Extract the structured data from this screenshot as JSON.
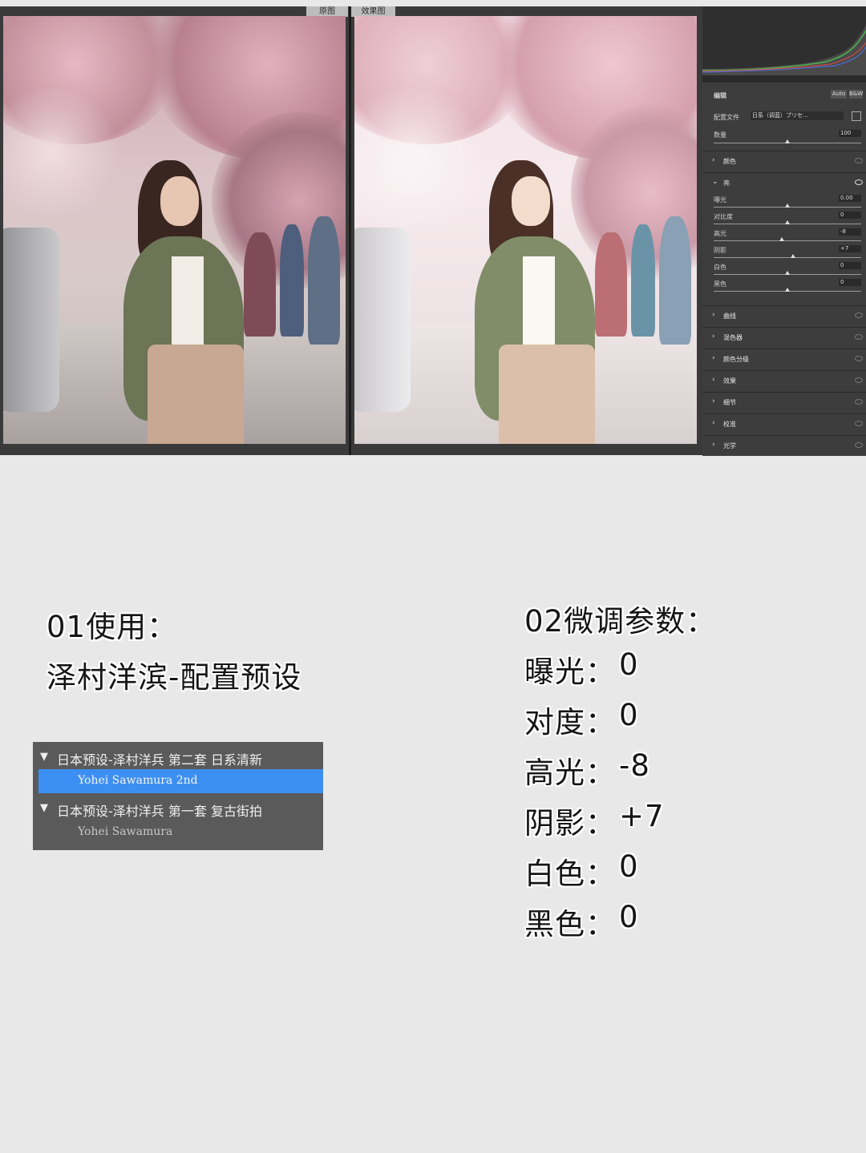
{
  "editor": {
    "tabs": {
      "original": "原图",
      "effect": "效果图"
    },
    "panel": {
      "edit_title": "编辑",
      "auto_btn": "Auto",
      "bw_btn": "B&W",
      "profile_label": "配置文件",
      "profile_value": "日系（调蓝）プリセ...",
      "amount_label": "数量",
      "amount_value": "100",
      "sections": {
        "color": "颜色",
        "light": "亮",
        "curve": "曲线",
        "mixer": "混色器",
        "grading": "颜色分级",
        "effects": "效果",
        "detail": "细节",
        "calibration": "校准",
        "optics": "光学"
      },
      "sliders": [
        {
          "label": "曝光",
          "value": "0.00",
          "level": 0.5
        },
        {
          "label": "对比度",
          "value": "0",
          "level": 0.5
        },
        {
          "label": "高光",
          "value": "-8",
          "level": 0.46
        },
        {
          "label": "阴影",
          "value": "+7",
          "level": 0.54
        },
        {
          "label": "白色",
          "value": "0",
          "level": 0.5
        },
        {
          "label": "黑色",
          "value": "0",
          "level": 0.5
        }
      ]
    }
  },
  "step1": {
    "heading": "01使用：",
    "subheading": "泽村洋滨-配置预设"
  },
  "presets": [
    {
      "group": "日本预设-泽村洋兵 第二套 日系清新",
      "item": "Yohei Sawamura 2nd",
      "selected": true
    },
    {
      "group": "日本预设-泽村洋兵 第一套 复古街拍",
      "item": "Yohei Sawamura",
      "selected": false
    }
  ],
  "step2": {
    "heading": "02微调参数：",
    "params": [
      {
        "name": "曝光：",
        "value": "0"
      },
      {
        "name": "对度：",
        "value": "0"
      },
      {
        "name": "高光：",
        "value": "-8"
      },
      {
        "name": "阴影：",
        "value": "+7"
      },
      {
        "name": "白色：",
        "value": "0"
      },
      {
        "name": "黑色：",
        "value": "0"
      }
    ]
  },
  "colors": {
    "preset_highlight": "#3c8ff2",
    "panel_bg": "#3d3d3d",
    "page_bg": "#e8e8e8"
  }
}
